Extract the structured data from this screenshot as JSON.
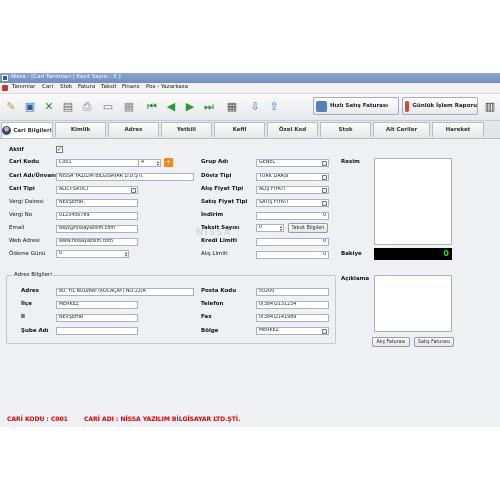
{
  "window": {
    "title": "Nissa - [Cari Tanımları | Kayıt Sayısı : 5 ]"
  },
  "menu": [
    "Tanımlar",
    "Cari",
    "Stok",
    "Fatura",
    "Taksit",
    "Finans",
    "Pos - Yazarkasa"
  ],
  "toolbar": {
    "quick_invoice_label": "Hızlı Satış Faturası",
    "daily_report_label": "Günlük İşlem Raporu"
  },
  "tabs": [
    "Cari Bilgileri",
    "Kimlik",
    "Adres",
    "Yetkili",
    "Kefil",
    "Özel Kod",
    "Stok",
    "Alt Cariler",
    "Hareket"
  ],
  "form": {
    "aktif_label": "Aktif",
    "aktif_checked": "✓",
    "cari_kodu": {
      "label": "Cari Kodu",
      "value": "C001",
      "extra": "4"
    },
    "cari_adi": {
      "label": "Cari Adı/Ünvanı",
      "value": "NİSSA YAZILIM BİLGİSAYAR LTD.ŞTİ."
    },
    "cari_tipi": {
      "label": "Cari Tipi",
      "value": "ALICI-SATICI"
    },
    "vergi_dairesi": {
      "label": "Vergi Dairesi",
      "value": "NEVŞEHİR"
    },
    "vergi_no": {
      "label": "Vergi No",
      "value": "0123456789"
    },
    "email": {
      "label": "Email",
      "value": "bayi@nissayazilim.com"
    },
    "web": {
      "label": "Web Adresi",
      "value": "www.nissayazilim.com"
    },
    "odeme_gunu": {
      "label": "Ödeme Günü",
      "value": "0"
    },
    "grup_adi": {
      "label": "Grup Adı",
      "value": "GENEL"
    },
    "doviz_tipi": {
      "label": "Döviz Tipi",
      "value": "TÜRK LİRASI"
    },
    "alis_fiyat": {
      "label": "Alış Fiyat Tipi",
      "value": "ALIŞ FİYATI"
    },
    "satis_fiyat": {
      "label": "Satış Fiyat Tipi",
      "value": "SATIŞ FİYATI"
    },
    "indirim": {
      "label": "İndirim",
      "value": "0"
    },
    "taksit_sayisi": {
      "label": "Taksit Sayısı",
      "value": "0",
      "button": "Taksit Bilgileri"
    },
    "kredi_limiti": {
      "label": "Kredi Limiti",
      "value": "0"
    },
    "alis_limiti": {
      "label": "Alış Limiti",
      "value": "0"
    },
    "resim_label": "Resim",
    "bakiye_label": "Bakiye",
    "bakiye_value": "0",
    "aciklama_label": "Açıklama",
    "alis_faturasi_button": "Alış Faturası",
    "satis_faturasi_button": "Satış Faturası"
  },
  "address": {
    "group_title": "Adres Bilgileri",
    "adres": {
      "label": "Adres",
      "value": "80. YIL BULVARI (KOCAÇAY) NO:22/A"
    },
    "ilce": {
      "label": "İlçe",
      "value": "MERKEZ"
    },
    "il": {
      "label": "İl",
      "value": "NEVŞEHİR"
    },
    "sube": {
      "label": "Şube Adı",
      "value": ""
    },
    "posta_kodu": {
      "label": "Posta Kodu",
      "value": "50200"
    },
    "telefon": {
      "label": "Telefon",
      "value": "0(384)2131234"
    },
    "fax": {
      "label": "Fax",
      "value": "0(384)2141989"
    },
    "bolge": {
      "label": "Bölge",
      "value": "MERKEZ"
    }
  },
  "status": {
    "cari_kodu": "CARİ KODU : C001",
    "cari_adi": "CARİ ADI : NİSSA YAZILIM BİLGİSAYAR LTD.ŞTİ."
  },
  "colors": {
    "accent": "#2d5fa8",
    "status_text": "#dd0000",
    "balance_bg": "#000000",
    "balance_text": "#22dd22"
  }
}
